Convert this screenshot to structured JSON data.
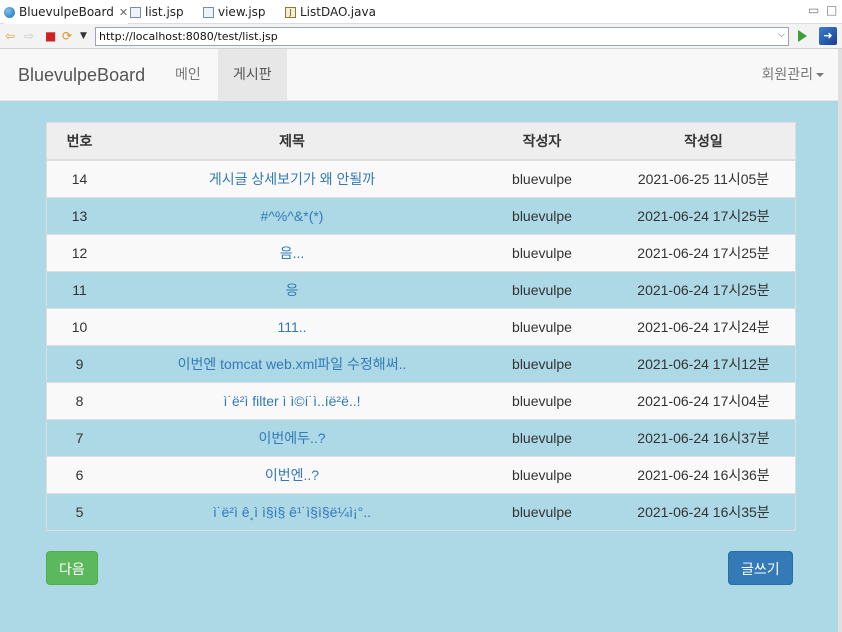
{
  "editor_tabs": [
    {
      "label": "BluevulpeBoard",
      "icon": "globe-icon",
      "closable": true,
      "active": true
    },
    {
      "label": "list.jsp",
      "icon": "jsp-file-icon"
    },
    {
      "label": "view.jsp",
      "icon": "jsp-file-icon"
    },
    {
      "label": "ListDAO.java",
      "icon": "java-file-icon"
    }
  ],
  "browser": {
    "url": "http://localhost:8080/test/list.jsp"
  },
  "navbar": {
    "brand": "BluevulpeBoard",
    "links": [
      {
        "label": "메인",
        "active": false
      },
      {
        "label": "게시판",
        "active": true
      }
    ],
    "right_menu": "회원관리"
  },
  "table": {
    "headers": [
      "번호",
      "제목",
      "작성자",
      "작성일"
    ],
    "rows": [
      {
        "no": "14",
        "title": "게시글 상세보기가 왜 안될까",
        "writer": "bluevulpe",
        "date": "2021-06-25 11시05분"
      },
      {
        "no": "13",
        "title": "#^%^&*(*)",
        "writer": "bluevulpe",
        "date": "2021-06-24 17시25분"
      },
      {
        "no": "12",
        "title": "음...",
        "writer": "bluevulpe",
        "date": "2021-06-24 17시25분"
      },
      {
        "no": "11",
        "title": "응",
        "writer": "bluevulpe",
        "date": "2021-06-24 17시25분"
      },
      {
        "no": "10",
        "title": "111..",
        "writer": "bluevulpe",
        "date": "2021-06-24 17시24분"
      },
      {
        "no": "9",
        "title": "이번엔 tomcat web.xml파일 수정해써..",
        "writer": "bluevulpe",
        "date": "2021-06-24 17시12분"
      },
      {
        "no": "8",
        "title": "ì˙ë²ì filter ì ì©í˙ì..íë²ë..!",
        "writer": "bluevulpe",
        "date": "2021-06-24 17시04분"
      },
      {
        "no": "7",
        "title": "이번에두..?",
        "writer": "bluevulpe",
        "date": "2021-06-24 16시37분"
      },
      {
        "no": "6",
        "title": "이번엔..?",
        "writer": "bluevulpe",
        "date": "2021-06-24 16시36분"
      },
      {
        "no": "5",
        "title": "ì˙ë²ì ê¸ì ì§ì§ ê¹˙ì§ì§ë¼ì¡°..",
        "writer": "bluevulpe",
        "date": "2021-06-24 16시35분"
      }
    ]
  },
  "buttons": {
    "next": "다음",
    "write": "글쓰기"
  },
  "colors": {
    "page_background": "#add8e6",
    "link": "#337ab7",
    "next_button": "#5cb85c",
    "write_button": "#337ab7"
  }
}
